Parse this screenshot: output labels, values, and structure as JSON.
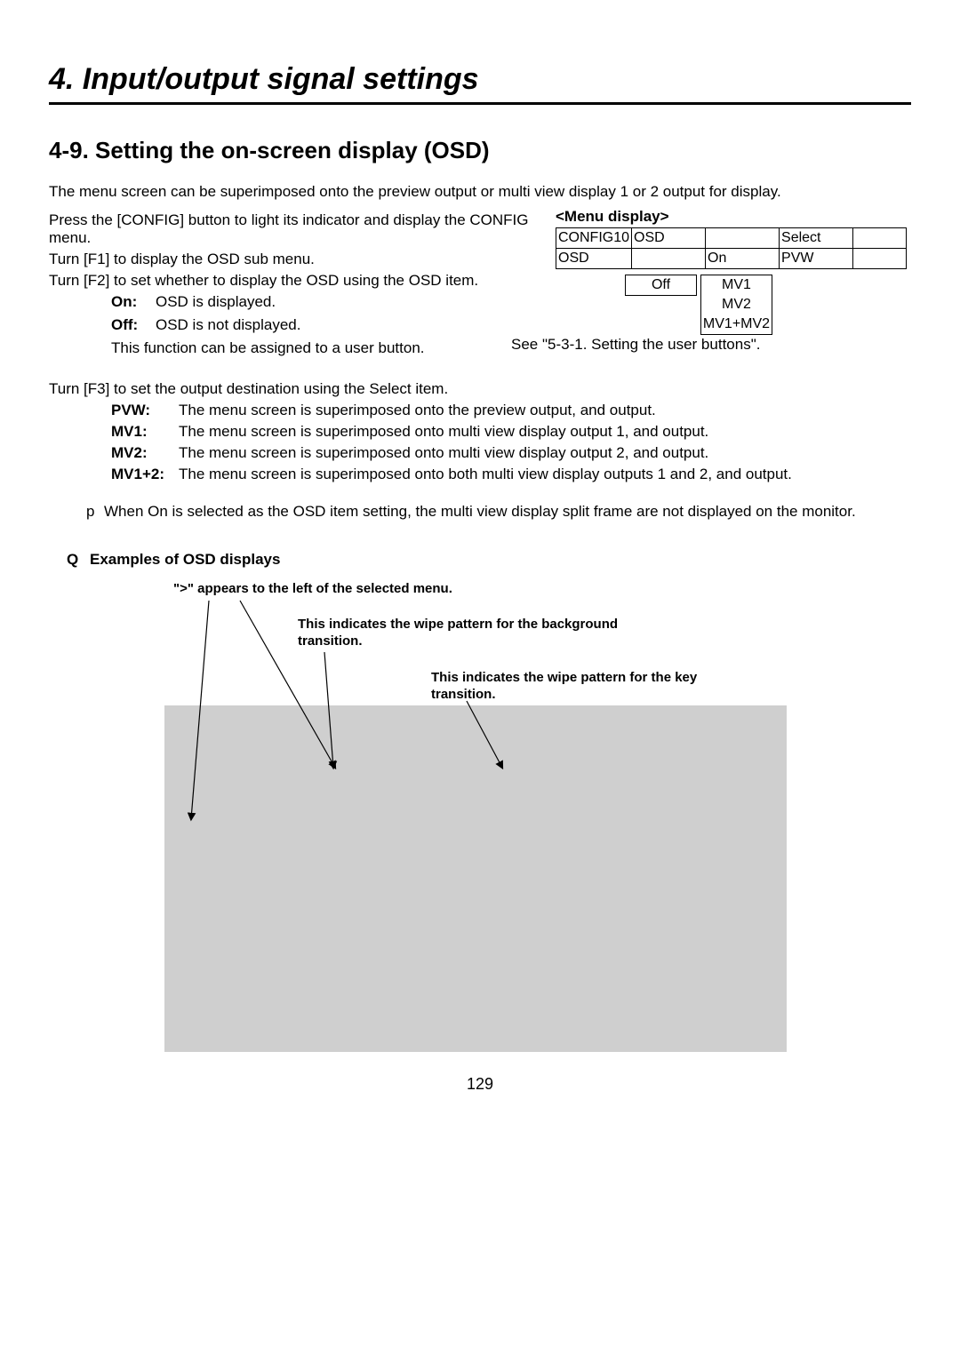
{
  "chapter": "4. Input/output signal settings",
  "section": "4-9. Setting the on-screen display (OSD)",
  "intro": "The menu screen can be superimposed onto the preview output or multi view display 1 or 2 output for display.",
  "step1": "Press the [CONFIG] button to light its indicator and display the CONFIG menu.",
  "step2": "Turn [F1] to display the OSD sub menu.",
  "step3": "Turn [F2] to set whether to display the OSD using the OSD item.",
  "on_label": "On:",
  "on_text": "OSD is displayed.",
  "off_label": "Off:",
  "off_text": "OSD is not displayed.",
  "assign_a": "This function can be assigned to a user button.",
  "assign_b": "See \"5-3-1. Setting the user buttons\".",
  "step4": "Turn [F3] to set the output destination using the Select item.",
  "defs": {
    "pvw_l": "PVW:",
    "pvw_t": "The menu screen is superimposed onto the preview output, and output.",
    "mv1_l": "MV1:",
    "mv1_t": "The menu screen is superimposed onto multi view display output 1, and output.",
    "mv2_l": "MV2:",
    "mv2_t": "The menu screen is superimposed onto multi view display output 2, and output.",
    "mv12_l": "MV1+2:",
    "mv12_t": "The menu screen is superimposed onto both multi view display outputs 1 and 2, and output."
  },
  "bullet_marker": "p",
  "bullet_text": "When On is selected as the OSD item setting, the multi view display split frame are not displayed on the monitor.",
  "menu_label": "<Menu display>",
  "menu_row1": {
    "c1": "CONFIG10",
    "c2": "OSD",
    "c3": "",
    "c4": "Select",
    "c5": ""
  },
  "menu_row2": {
    "c1": "OSD",
    "c2": "",
    "c3": "On",
    "c4": "PVW",
    "c5": ""
  },
  "opt_left": "Off",
  "opt_right1": "MV1",
  "opt_right2": "MV2",
  "opt_right3": "MV1+MV2",
  "q_marker": "Q",
  "q_text": "Examples of OSD displays",
  "ann1": "\">\" appears to the left of the selected menu.",
  "ann2": "This indicates the wipe pattern for the background transition.",
  "ann3": "This indicates the wipe pattern for the key transition.",
  "page_number": "129"
}
